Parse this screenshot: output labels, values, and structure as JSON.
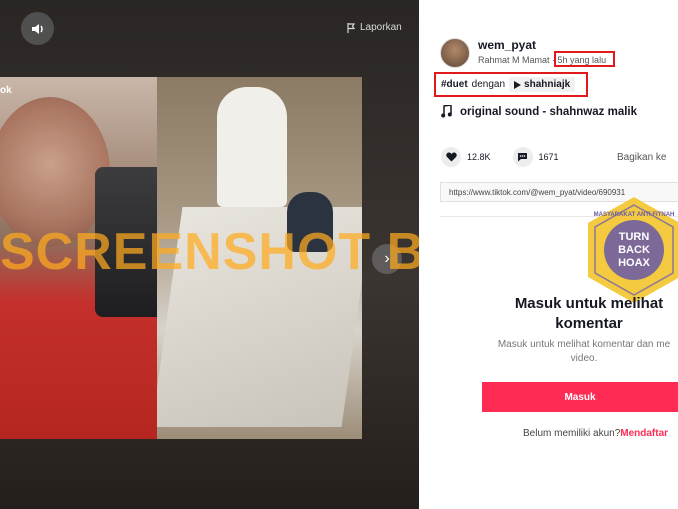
{
  "video_panel": {
    "report_label": "Laporkan",
    "overlay_handle": "ok",
    "watermark_text": "SCREENSHOT BY",
    "icons": {
      "volume": "speaker-icon",
      "report": "flag-icon",
      "next": "chevron-right-icon"
    }
  },
  "post": {
    "username": "wem_pyat",
    "display_name": "Rahmat M Mamat",
    "separator": " · ",
    "time_ago": "5h yang lalu",
    "duet_tag": "#duet",
    "duet_with": "dengan",
    "duet_user": "shahniajk",
    "sound": "original sound - shahnwaz malik",
    "likes": "12.8K",
    "comments": "1671",
    "share_label": "Bagikan ke",
    "url": "https://www.tiktok.com/@wem_pyat/video/690931"
  },
  "badge": {
    "text_lines": [
      "TURN",
      "BACK",
      "HOAX"
    ],
    "ring_text": "MASYARAKAT ANTI FITNAH"
  },
  "login": {
    "title_line1": "Masuk untuk melihat",
    "title_line2": "komentar",
    "subtitle_line1": "Masuk untuk melihat komentar dan me",
    "subtitle_line2": "video.",
    "button_label": "Masuk",
    "signup_prompt": "Belum memiliki akun?",
    "signup_link": "Mendaftar"
  },
  "colors": {
    "accent": "#fe2c55",
    "highlight_box": "#e1191c",
    "watermark": "#ffaa1e"
  }
}
